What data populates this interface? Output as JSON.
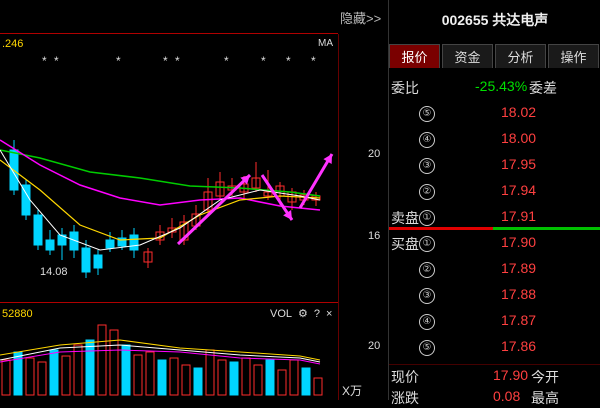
{
  "chart": {
    "hide_label": "隐藏>>",
    "ma_value": ".246",
    "ma_label": "MA",
    "star_char": "*",
    "price_axis": {
      "top": "20",
      "bottom": "16"
    },
    "low_annotation": "14.08",
    "volume": {
      "value": "52880",
      "title": "VOL",
      "gear_icon": "gear-icon",
      "help": "?",
      "close": "×",
      "axis_top": "20",
      "unit": "X万"
    },
    "colors": {
      "up": "#ff2d2d",
      "down": "#00d5ff",
      "ma5": "#ffffff",
      "ma10": "#ffd700",
      "ma20": "#ff00ff",
      "ma60": "#00cc00",
      "arrow": "#ff33ff",
      "grid": "#b00000"
    }
  },
  "side": {
    "code": "002655",
    "name": "共达电声",
    "tabs": [
      {
        "label": "报价",
        "active": true
      },
      {
        "label": "资金",
        "active": false
      },
      {
        "label": "分析",
        "active": false
      },
      {
        "label": "操作",
        "active": false
      }
    ],
    "weibi": {
      "label": "委比",
      "value": "-25.43%",
      "diff_label": "委差"
    },
    "sell": [
      {
        "idx": "⑤",
        "price": "18.02"
      },
      {
        "idx": "④",
        "price": "18.00"
      },
      {
        "idx": "③",
        "price": "17.95"
      },
      {
        "idx": "②",
        "price": "17.94"
      },
      {
        "idx": "①",
        "price": "17.91",
        "label": "卖盘"
      }
    ],
    "buy": [
      {
        "idx": "①",
        "price": "17.90",
        "label": "买盘"
      },
      {
        "idx": "②",
        "price": "17.89"
      },
      {
        "idx": "③",
        "price": "17.88"
      },
      {
        "idx": "④",
        "price": "17.87"
      },
      {
        "idx": "⑤",
        "price": "17.86"
      }
    ],
    "current": {
      "label": "现价",
      "value": "17.90",
      "right_label": "今开"
    },
    "change": {
      "label": "涨跌",
      "value": "0.08",
      "right_label": "最高"
    }
  }
}
